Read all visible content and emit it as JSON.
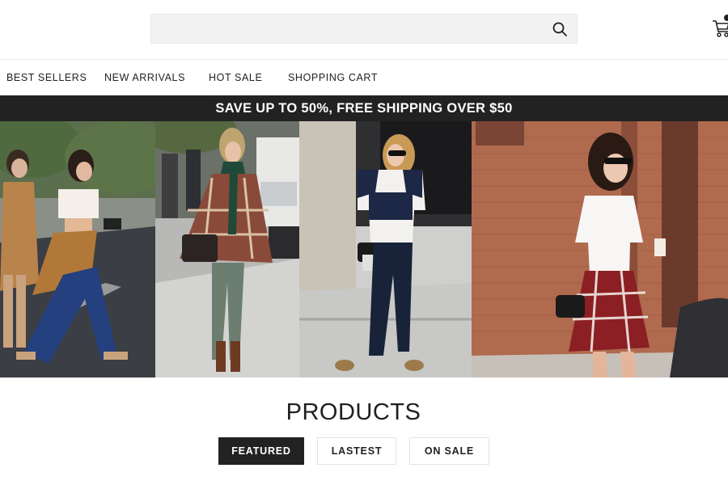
{
  "search": {
    "value": "",
    "placeholder": ""
  },
  "nav": {
    "items": [
      {
        "label": "BEST SELLERS"
      },
      {
        "label": "NEW ARRIVALS"
      },
      {
        "label": "HOT SALE"
      },
      {
        "label": "SHOPPING CART"
      }
    ]
  },
  "promo": {
    "text": "SAVE UP TO 50%, FREE SHIPPING OVER $50"
  },
  "hero": {
    "photos": [
      {
        "subject": "two women crossing a street in camel coat and cropped top"
      },
      {
        "subject": "woman in plaid poncho and green scarf with black handbag"
      },
      {
        "subject": "woman in navy and white tee, dark jeans, leopard slip-ons"
      },
      {
        "subject": "woman in white tee with plaid shirt tied at waist, holding coffee"
      }
    ]
  },
  "products": {
    "title": "PRODUCTS",
    "tabs": [
      {
        "label": "FEATURED",
        "active": true
      },
      {
        "label": "LASTEST",
        "active": false
      },
      {
        "label": "ON SALE",
        "active": false
      }
    ]
  },
  "icons": {
    "search": "search-icon",
    "cart": "cart-icon"
  },
  "colors": {
    "dark": "#222222",
    "search_bg": "#f2f2f2",
    "tab_border": "#e3e3e3"
  }
}
